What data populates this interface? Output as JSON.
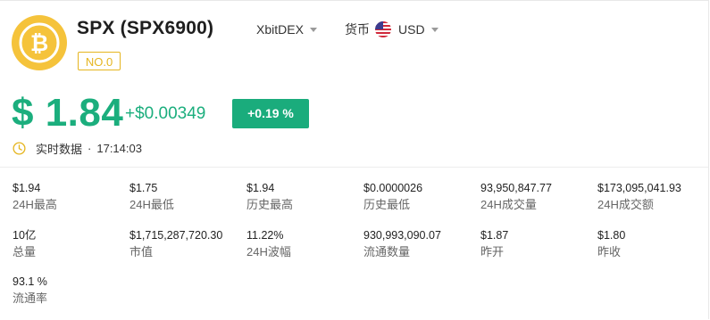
{
  "coin": {
    "name": "SPX (SPX6900)",
    "rank": "NO.0",
    "logo_icon": "bitcoin-icon",
    "logo_color": "#f5c33b"
  },
  "selectors": {
    "exchange": "XbitDEX",
    "currency_label": "货币",
    "currency_value": "USD",
    "flag_icon": "us-flag-icon"
  },
  "price": {
    "value": "$ 1.84",
    "change_abs": "+$0.00349",
    "change_pct": "+0.19 %",
    "color_up": "#1bae7d"
  },
  "realtime": {
    "label": "实时数据",
    "separator": "·",
    "time": "17:14:03",
    "icon": "clock-icon"
  },
  "stats": [
    {
      "value": "$1.94",
      "label": "24H最高"
    },
    {
      "value": "$1.75",
      "label": "24H最低"
    },
    {
      "value": "$1.94",
      "label": "历史最高"
    },
    {
      "value": "$0.0000026",
      "label": "历史最低"
    },
    {
      "value": "93,950,847.77",
      "label": "24H成交量"
    },
    {
      "value": "$173,095,041.93",
      "label": "24H成交额"
    },
    {
      "value": "10亿",
      "label": "总量"
    },
    {
      "value": "$1,715,287,720.30",
      "label": "市值"
    },
    {
      "value": "11.22%",
      "label": "24H波幅"
    },
    {
      "value": "930,993,090.07",
      "label": "流通数量"
    },
    {
      "value": "$1.87",
      "label": "昨开"
    },
    {
      "value": "$1.80",
      "label": "昨收"
    },
    {
      "value": "93.1 %",
      "label": "流通率"
    }
  ]
}
